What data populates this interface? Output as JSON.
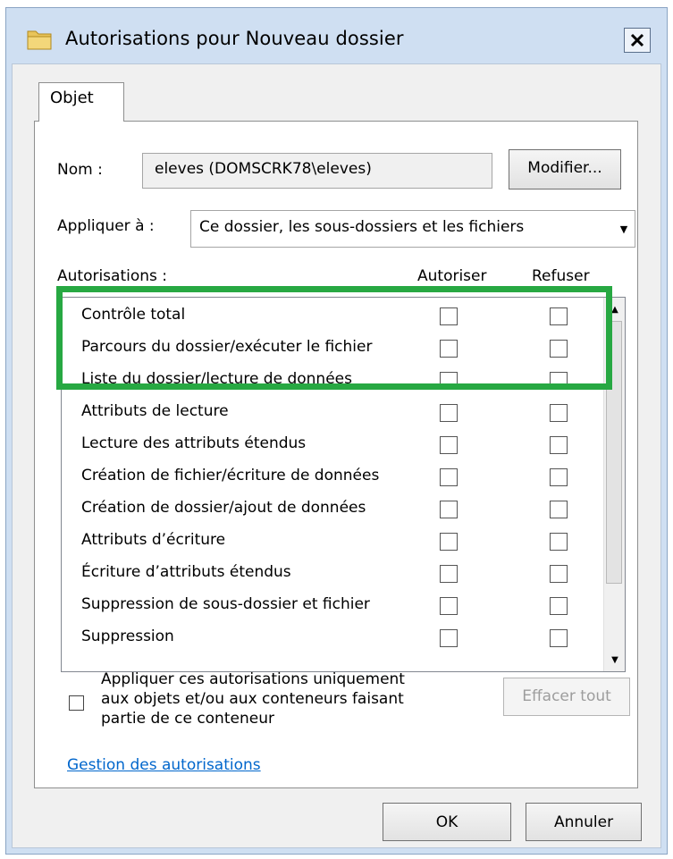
{
  "window": {
    "title": "Autorisations pour Nouveau dossier",
    "close_label": "✕"
  },
  "tab": {
    "label": "Objet"
  },
  "name_row": {
    "label": "Nom :",
    "value": "eleves (DOMSCRK78\\eleves)",
    "modify_label": "Modifier..."
  },
  "apply_row": {
    "label": "Appliquer à :",
    "selected": "Ce dossier, les sous-dossiers et les fichiers"
  },
  "permissions": {
    "label": "Autorisations :",
    "col_allow": "Autoriser",
    "col_deny": "Refuser",
    "rows": [
      {
        "label": "Contrôle total",
        "allow": false,
        "deny": false
      },
      {
        "label": "Parcours du dossier/exécuter le fichier",
        "allow": false,
        "deny": false
      },
      {
        "label": "Liste du dossier/lecture de données",
        "allow": false,
        "deny": false
      },
      {
        "label": "Attributs de lecture",
        "allow": false,
        "deny": false
      },
      {
        "label": "Lecture des attributs étendus",
        "allow": false,
        "deny": false
      },
      {
        "label": "Création de fichier/écriture de données",
        "allow": false,
        "deny": false
      },
      {
        "label": "Création de dossier/ajout de données",
        "allow": false,
        "deny": false
      },
      {
        "label": "Attributs d’écriture",
        "allow": false,
        "deny": false
      },
      {
        "label": "Écriture d’attributs étendus",
        "allow": false,
        "deny": false
      },
      {
        "label": "Suppression de sous-dossier et fichier",
        "allow": false,
        "deny": false
      },
      {
        "label": "Suppression",
        "allow": false,
        "deny": false
      }
    ]
  },
  "apply_only": {
    "line1": "Appliquer ces autorisations uniquement",
    "line2": "aux objets et/ou aux conteneurs faisant",
    "line3": "partie de ce conteneur",
    "checked": false
  },
  "clear_all_label": "Effacer tout",
  "manage_link": "Gestion des autorisations",
  "buttons": {
    "ok": "OK",
    "cancel": "Annuler"
  },
  "colors": {
    "highlight": "#27a842",
    "link": "#0066cc",
    "titlebar": "#cfdff2"
  },
  "icons": {
    "window_icon": "folder-icon",
    "scroll_up": "scroll-up-arrow-icon",
    "scroll_down": "scroll-down-arrow-icon",
    "dropdown": "dropdown-arrow-icon"
  }
}
